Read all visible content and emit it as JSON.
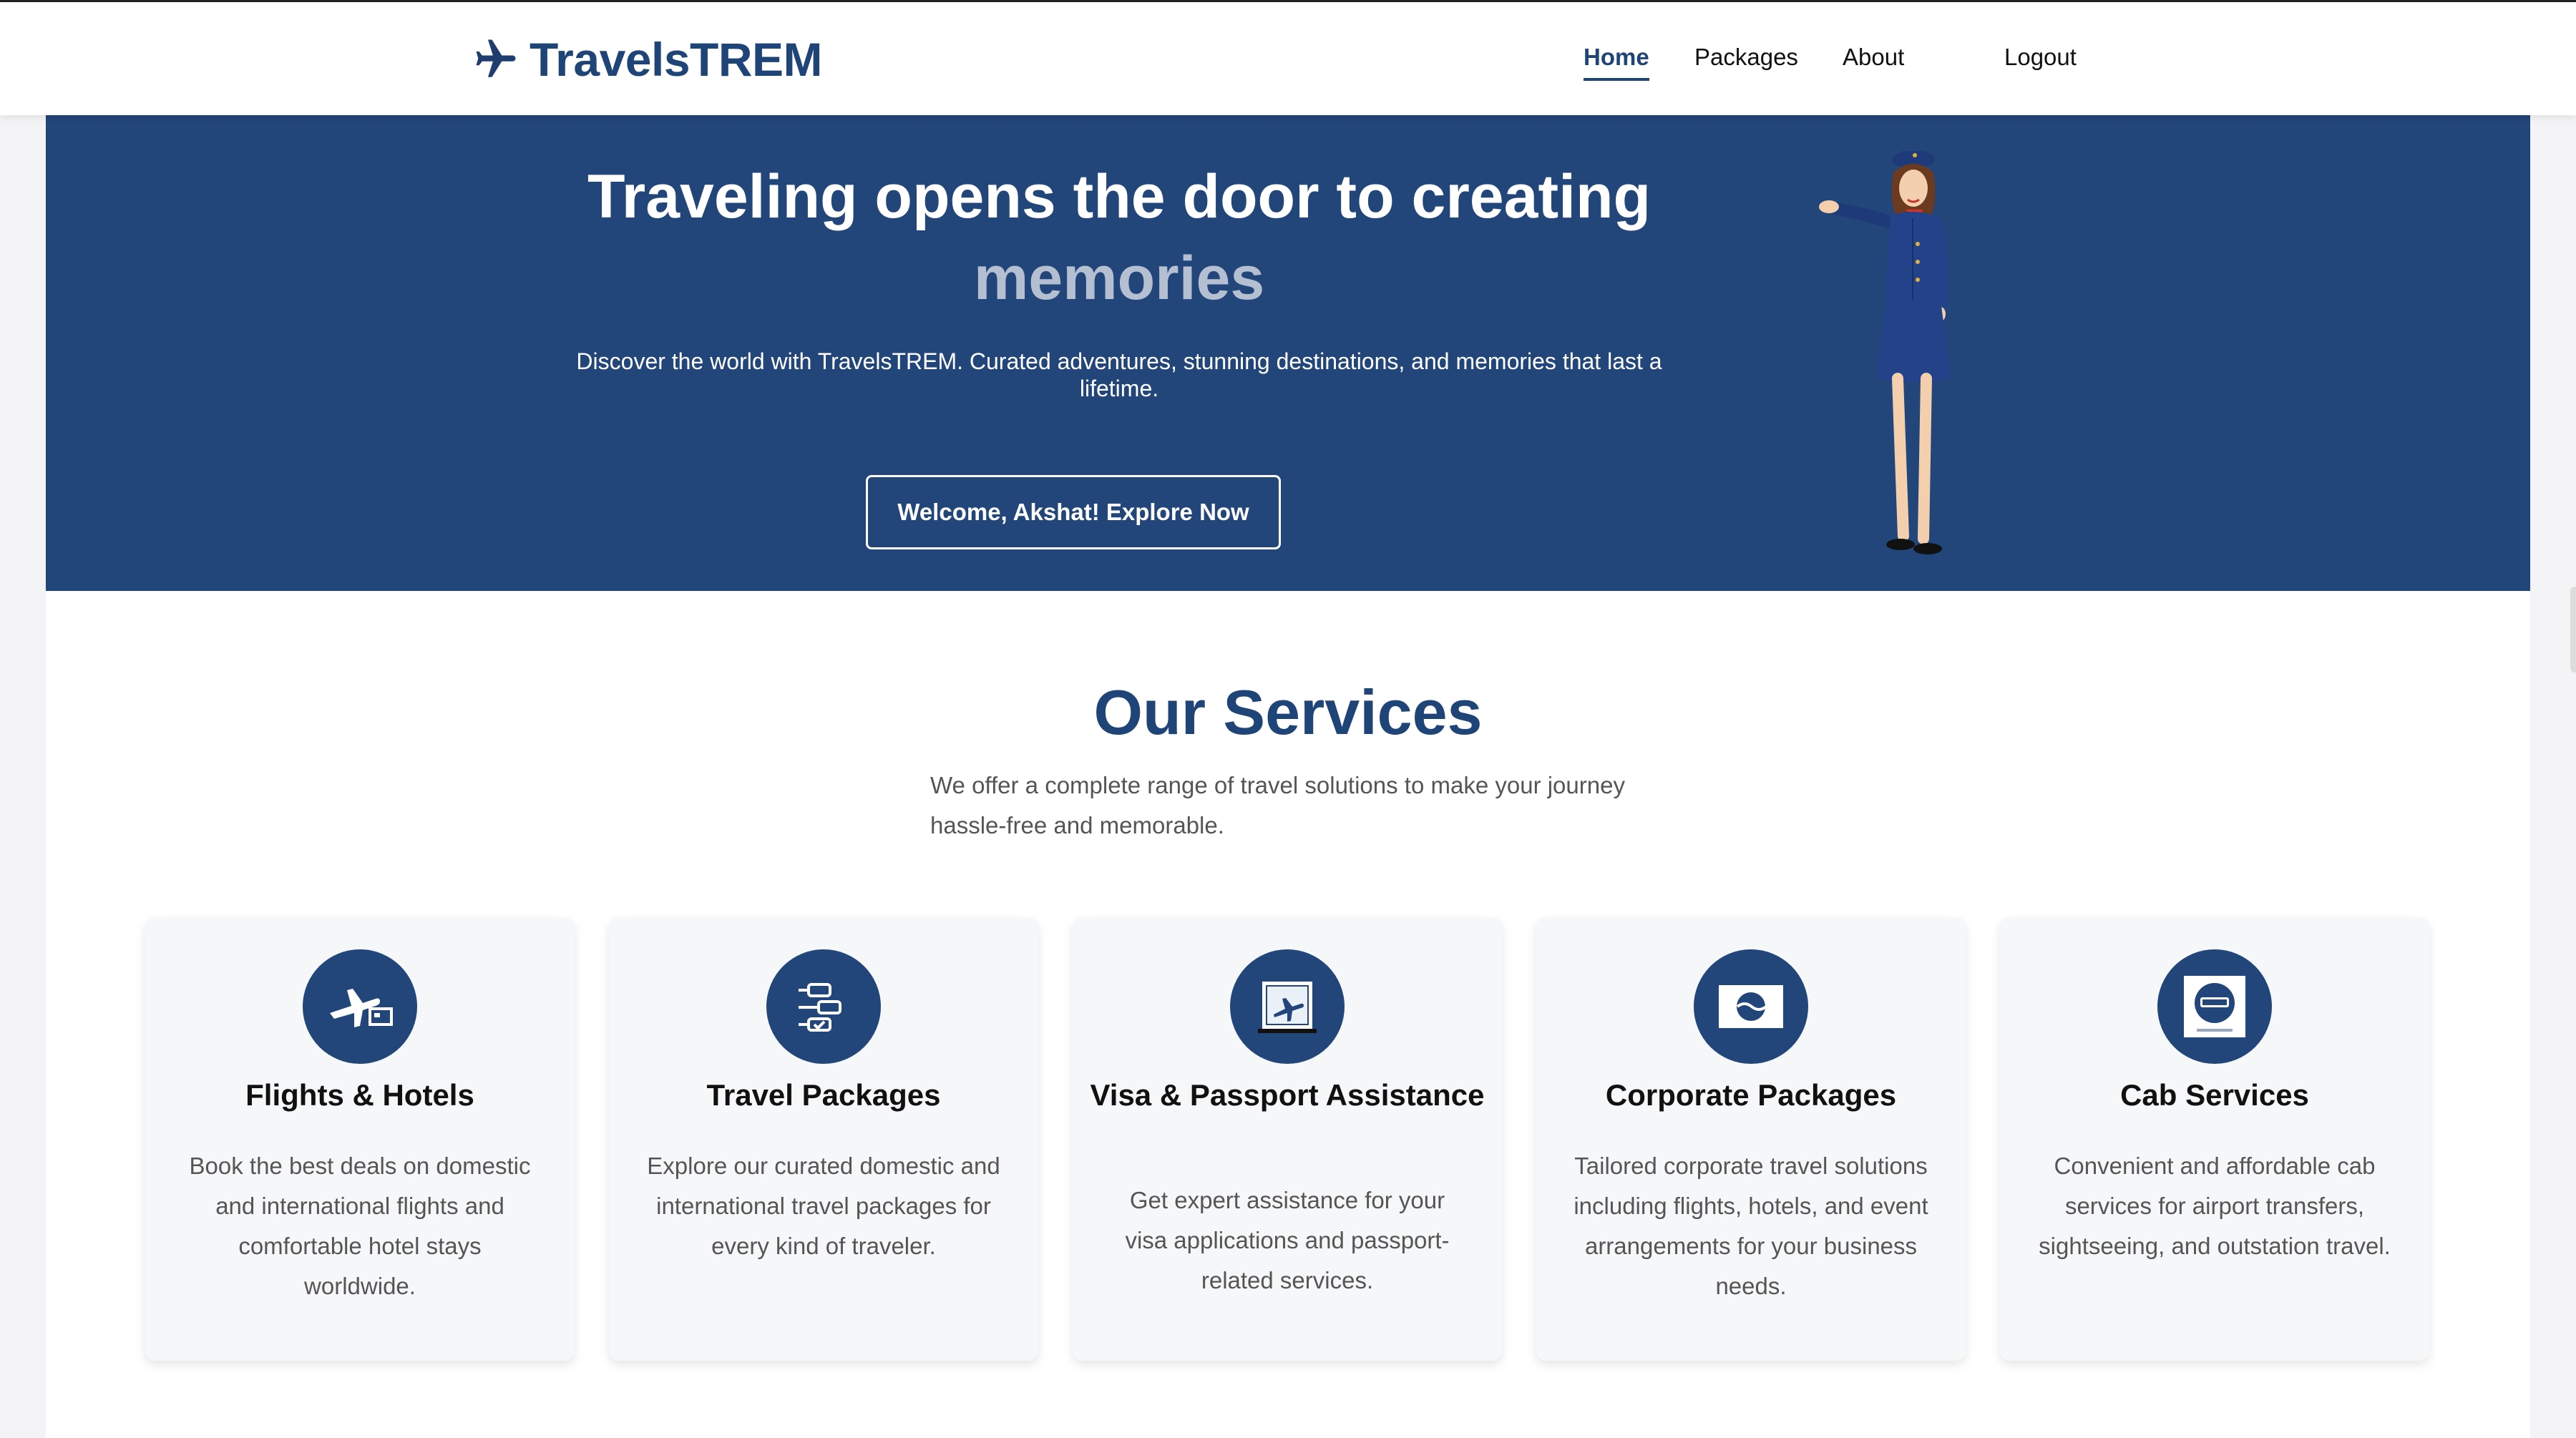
{
  "nav": {
    "brand": "TravelsTREM",
    "links": [
      {
        "label": "Home",
        "active": true
      },
      {
        "label": "Packages",
        "active": false
      },
      {
        "label": "About",
        "active": false
      },
      {
        "label": "Logout",
        "active": false
      }
    ]
  },
  "hero": {
    "title": "Traveling opens the door to creating",
    "highlight": "memories",
    "subtitle": "Discover the world with TravelsTREM. Curated adventures, stunning destinations, and memories that last a lifetime.",
    "cta": "Welcome, Akshat! Explore Now"
  },
  "services": {
    "title": "Our Services",
    "subtitle": "We offer a complete range of travel solutions to make your journey hassle-free and memorable.",
    "cards": [
      {
        "title": "Flights & Hotels",
        "text": "Book the best deals on domestic and international flights and comfortable hotel stays worldwide.",
        "icon": "flight-hotel-icon"
      },
      {
        "title": "Travel Packages",
        "text": "Explore our curated domestic and international travel packages for every kind of traveler.",
        "icon": "packages-icon"
      },
      {
        "title": "Visa & Passport Assistance",
        "text": "Get expert assistance for your visa applications and passport-related services.",
        "icon": "visa-icon"
      },
      {
        "title": "Corporate Packages",
        "text": "Tailored corporate travel solutions including flights, hotels, and event arrangements for your business needs.",
        "icon": "corporate-icon"
      },
      {
        "title": "Cab Services",
        "text": "Convenient and affordable cab services for airport transfers, sightseeing, and outstation travel.",
        "icon": "taxi-icon"
      }
    ]
  },
  "colors": {
    "primary": "#22457a",
    "highlight": "#b4bfd2"
  }
}
